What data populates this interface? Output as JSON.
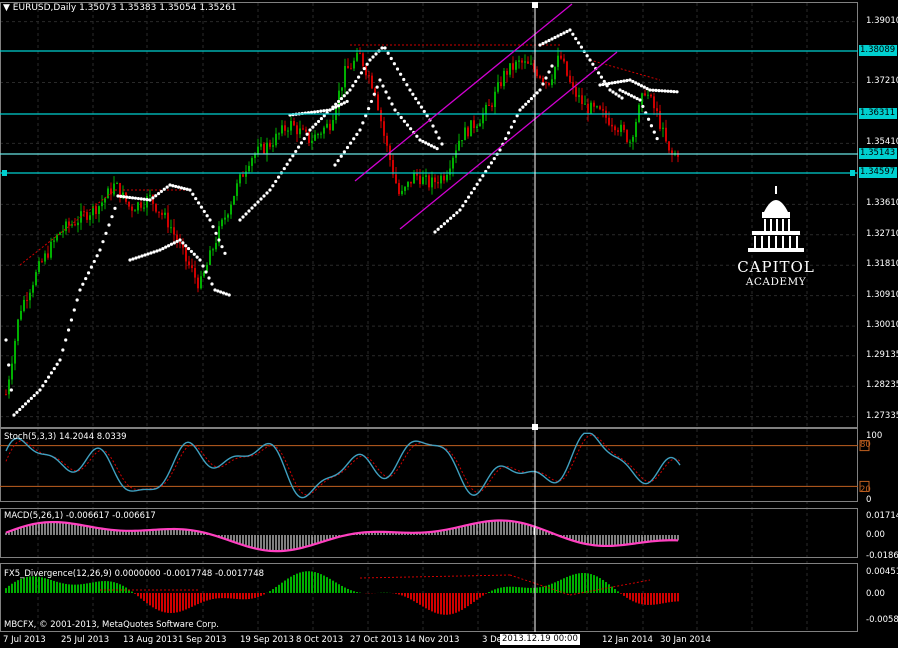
{
  "chart_header": {
    "symbol_label": "EURUSD,Daily",
    "ohlc": "1.35073 1.35383 1.35054 1.35261"
  },
  "price_axis": {
    "labels": [
      "1.39010",
      "1.37210",
      "1.35410",
      "1.33610",
      "1.32710",
      "1.31810",
      "1.30910",
      "1.30010",
      "1.29135",
      "1.28235",
      "1.27335"
    ],
    "highlighted": [
      {
        "value": "1.38089",
        "color": "#00d0d0"
      },
      {
        "value": "1.36311",
        "color": "#00d0d0"
      },
      {
        "value": "1.35143",
        "color": "#00d0d0"
      },
      {
        "value": "1.34597",
        "color": "#00d0d0"
      }
    ]
  },
  "time_axis": {
    "labels": [
      "7 Jul 2013",
      "25 Jul 2013",
      "13 Aug 2013",
      "1 Sep 2013",
      "19 Sep 2013",
      "8 Oct 2013",
      "27 Oct 2013",
      "14 Nov 2013",
      "3 Dec 2013",
      "12 Jan 2014",
      "30 Jan 2014"
    ],
    "crosshair_date": "2013.12.19 00:00"
  },
  "indicators": {
    "stoch": {
      "title": "Stoch(5,3,3) 14.2044 8.0339",
      "levels": [
        "100",
        "80",
        "20",
        "0"
      ]
    },
    "macd": {
      "title": "MACD(5,26,1) -0.006617 -0.006617",
      "levels": [
        "0.017148",
        "0.00",
        "-0.018668"
      ]
    },
    "fx5": {
      "title": "FX5_Divergence(12,26,9) 0.0000000 -0.0017748 -0.0017748",
      "levels": [
        "0.00451",
        "0.00",
        "-0.00585"
      ]
    }
  },
  "footer_copyright": "MBCFX, © 2001-2013, MetaQuotes Software Corp.",
  "logo": {
    "line1": "CAPITOL",
    "line2": "ACADEMY"
  },
  "colors": {
    "background": "#000000",
    "grid": "#2a2a2a",
    "bull": "#00b000",
    "bear": "#d00000",
    "levels": "#00d0d0",
    "channel": "#d000d0",
    "sar": "#ffffff",
    "stoch_main": "#40a0c0",
    "macd_signal": "#ff40c0",
    "level_line": "#c06020"
  }
}
